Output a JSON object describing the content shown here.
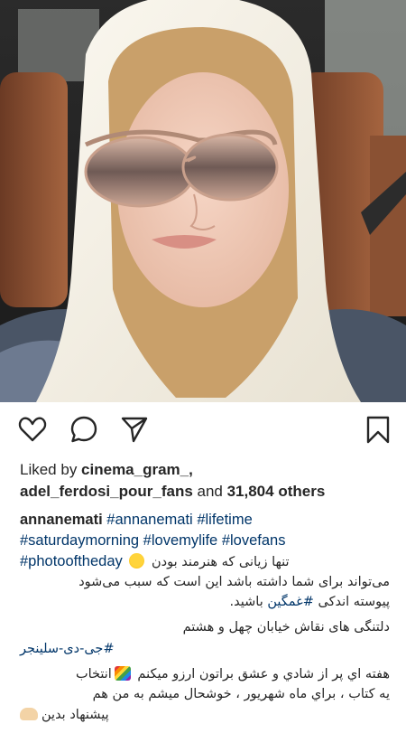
{
  "post": {
    "photo_alt": "selfie in car with white headscarf and sunglasses"
  },
  "actions": {
    "like_icon": "heart-outline-icon",
    "comment_icon": "comment-bubble-icon",
    "share_icon": "paper-plane-icon",
    "save_icon": "bookmark-icon"
  },
  "likes": {
    "prefix": "Liked by ",
    "user1": "cinema_gram_,",
    "user2": "adel_ferdosi_pour_fans",
    "and_text": " and ",
    "count": "31,804 others"
  },
  "caption": {
    "username": "annanemati",
    "tags_line1": [
      "#annanemati",
      "#lifetime"
    ],
    "tags_line2": [
      "#saturdaymorning",
      "#lovemylife",
      "#lovefans"
    ],
    "tag_line3": "#photooftheday",
    "fa_line1": "تنها زیانی که هنرمند بودن",
    "fa_line2": "می‌تواند برای شما داشته باشد این است که سبب می‌شود",
    "fa_line3_pre": "پیوسته اندکی ",
    "fa_line3_tag": "#غمگین",
    "fa_line3_post": " باشید.",
    "fa_line4": "دلتنگی های نقاش خیابان چهل و هشتم",
    "fa_tag_salinger": "#جی-دی-سلینجر",
    "fa_line6": "هفته اي پر از شادي و عشق براتون ارزو ميكنم",
    "fa_line6_end": "انتخاب",
    "fa_line7": "يه كتاب ، براي ماه شهريور ، خوشحال ميشم به من هم",
    "fa_line8": "پیشنهاد بدین"
  },
  "colors": {
    "text": "#262626",
    "hashtag": "#003569",
    "background": "#ffffff"
  }
}
